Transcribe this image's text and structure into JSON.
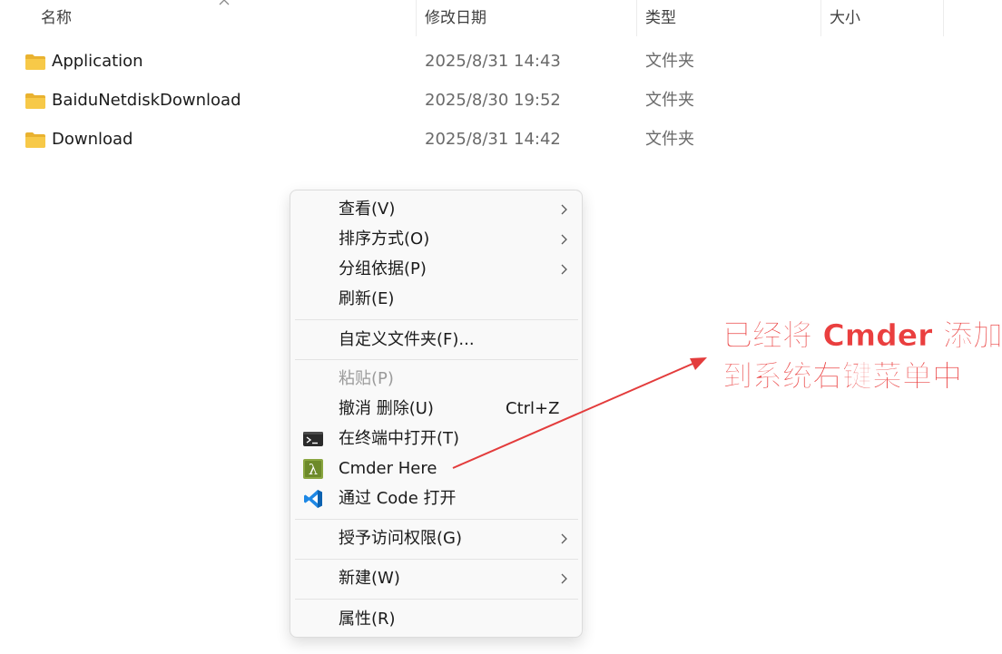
{
  "columns": {
    "name": "名称",
    "date": "修改日期",
    "type": "类型",
    "size": "大小"
  },
  "files": [
    {
      "name": "Application",
      "date": "2025/8/31 14:43",
      "type": "文件夹",
      "icon": "folder-icon"
    },
    {
      "name": "BaiduNetdiskDownload",
      "date": "2025/8/30 19:52",
      "type": "文件夹",
      "icon": "folder-icon"
    },
    {
      "name": "Download",
      "date": "2025/8/31 14:42",
      "type": "文件夹",
      "icon": "folder-icon"
    }
  ],
  "context_menu": {
    "view": "查看(V)",
    "sort": "排序方式(O)",
    "group": "分组依据(P)",
    "refresh": "刷新(E)",
    "customize": "自定义文件夹(F)...",
    "paste": "粘贴(P)",
    "undo": "撤消 删除(U)",
    "undo_shortcut": "Ctrl+Z",
    "open_terminal": "在终端中打开(T)",
    "cmder_here": "Cmder Here",
    "open_code": "通过 Code 打开",
    "give_access": "授予访问权限(G)",
    "new": "新建(W)",
    "properties": "属性(R)"
  },
  "annotation": {
    "line1": "已经将 Cmder 添加",
    "line2": "到系统右键菜单中",
    "color": "#ea3f3f"
  },
  "colors": {
    "folder": "#f7c948",
    "vscode": "#1e88e5",
    "cmder": "#8aa640"
  }
}
